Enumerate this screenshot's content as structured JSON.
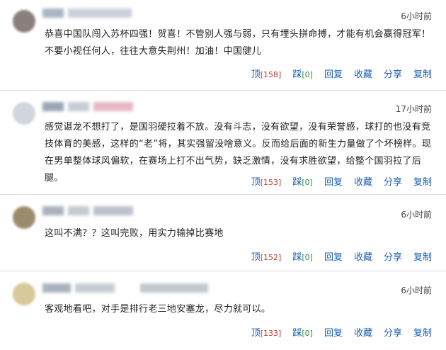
{
  "comments": [
    {
      "time": "6小时前",
      "text": "恭喜中国队闯入苏杯四强！贺喜！不管别人强与弱，只有埋头拼命搏，才能有机会赢得冠军！不要小视任何人，往往大意失荆州！加油！中国健儿",
      "actions": {
        "up_label": "顶",
        "up_count": "[158]",
        "down_label": "踩",
        "down_count": "[0]",
        "reply": "回复",
        "fav": "收藏",
        "share": "分享",
        "copy": "复制"
      }
    },
    {
      "time": "17小时前",
      "text": "感觉谌龙不想打了，是国羽硬拉着不放。没有斗志，没有欲望，没有荣誉感，球打的也没有竞技体育的美感，这样的“老”将，其实强留没啥意义。反而给后面的新生力量做了个坏榜样。现在男单整体球风偏软，在赛场上打不出气势，缺乏激情，没有求胜欲望，给整个国羽拉了后腿。",
      "actions": {
        "up_label": "顶",
        "up_count": "[153]",
        "down_label": "踩",
        "down_count": "[0]",
        "reply": "回复",
        "fav": "收藏",
        "share": "分享",
        "copy": "复制"
      }
    },
    {
      "time": "6小时前",
      "text": "这叫不满？？这叫完败，用实力输掉比赛地",
      "actions": {
        "up_label": "顶",
        "up_count": "[152]",
        "down_label": "踩",
        "down_count": "[0]",
        "reply": "回复",
        "fav": "收藏",
        "share": "分享",
        "copy": "复制"
      }
    },
    {
      "time": "6小时前",
      "text": "客观地看吧，对手是排行老三地安塞龙，尽力就可以。",
      "actions": {
        "up_label": "顶",
        "up_count": "[133]",
        "down_label": "踩",
        "down_count": "[0]",
        "reply": "回复",
        "fav": "收藏",
        "share": "分享",
        "copy": "复制"
      }
    }
  ],
  "colors": {
    "link": "#1b5fb0",
    "up_count": "#c0392b",
    "down_count": "#2e8b3a",
    "divider": "#dcdcdc"
  }
}
